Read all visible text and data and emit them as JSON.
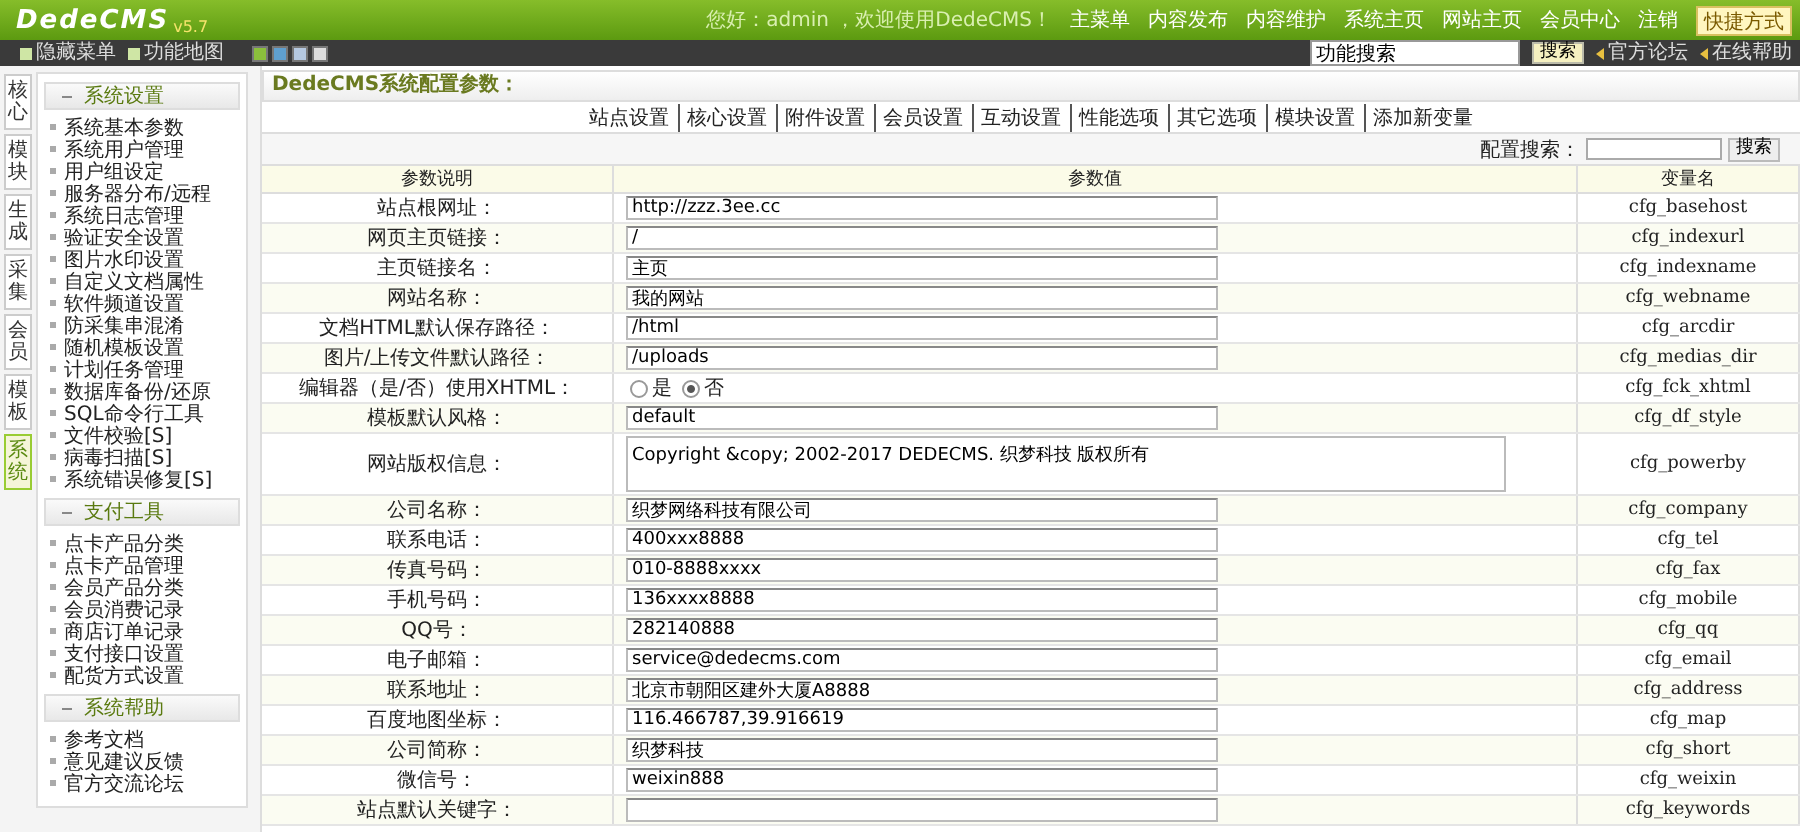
{
  "header": {
    "logo": "DedeCMS",
    "version": "v5.7",
    "greeting": "您好：admin ，欢迎使用DedeCMS！",
    "menu": [
      "主菜单",
      "内容发布",
      "内容维护",
      "系统主页",
      "网站主页",
      "会员中心",
      "注销"
    ],
    "shortcut": "快捷方式"
  },
  "toolbar": {
    "links": [
      "隐藏菜单",
      "功能地图"
    ],
    "search": {
      "value": "功能搜索"
    },
    "search_button": "搜索",
    "help_links": [
      "官方论坛",
      "在线帮助"
    ]
  },
  "side_tabs": [
    {
      "label": "核心",
      "selected": false
    },
    {
      "label": "模块",
      "selected": false
    },
    {
      "label": "生成",
      "selected": false
    },
    {
      "label": "采集",
      "selected": false
    },
    {
      "label": "会员",
      "selected": false
    },
    {
      "label": "模板",
      "selected": false
    },
    {
      "label": "系统",
      "selected": true
    }
  ],
  "sidebar": {
    "groups": [
      {
        "title": "系统设置",
        "expanded": true,
        "items": [
          "系统基本参数",
          "系统用户管理",
          "用户组设定",
          "服务器分布/远程",
          "系统日志管理",
          "验证安全设置",
          "图片水印设置",
          "自定义文档属性",
          "软件频道设置",
          "防采集串混淆",
          "随机模板设置",
          "计划任务管理",
          "数据库备份/还原",
          "SQL命令行工具",
          "文件校验[S]",
          "病毒扫描[S]",
          "系统错误修复[S]"
        ]
      },
      {
        "title": "支付工具",
        "expanded": true,
        "items": [
          "点卡产品分类",
          "点卡产品管理",
          "会员产品分类",
          "会员消费记录",
          "商店订单记录",
          "支付接口设置",
          "配货方式设置"
        ]
      },
      {
        "title": "系统帮助",
        "expanded": true,
        "items": [
          "参考文档",
          "意见建议反馈",
          "官方交流论坛"
        ]
      }
    ]
  },
  "main": {
    "title": "DedeCMS系统配置参数：",
    "tabs": [
      {
        "label": "站点设置",
        "selected": false
      },
      {
        "label": "核心设置",
        "selected": false
      },
      {
        "label": "附件设置",
        "selected": false
      },
      {
        "label": "会员设置",
        "selected": false
      },
      {
        "label": "互动设置",
        "selected": false
      },
      {
        "label": "性能选项",
        "selected": false
      },
      {
        "label": "其它选项",
        "selected": false
      },
      {
        "label": "模块设置",
        "selected": false
      },
      {
        "label": "添加新变量",
        "selected": false
      }
    ],
    "search_label": "配置搜索：",
    "search_button": "搜索",
    "columns": [
      "参数说明",
      "参数值",
      "变量名"
    ],
    "rows": [
      {
        "kind": "text",
        "label": "站点根网址：",
        "value": "http://zzz.3ee.cc",
        "variable": "cfg_basehost"
      },
      {
        "kind": "text",
        "label": "网页主页链接：",
        "value": "/",
        "variable": "cfg_indexurl"
      },
      {
        "kind": "text",
        "label": "主页链接名：",
        "value": "主页",
        "variable": "cfg_indexname"
      },
      {
        "kind": "text",
        "label": "网站名称：",
        "value": "我的网站",
        "variable": "cfg_webname"
      },
      {
        "kind": "text",
        "label": "文档HTML默认保存路径：",
        "value": "/html",
        "variable": "cfg_arcdir"
      },
      {
        "kind": "text",
        "label": "图片/上传文件默认路径：",
        "value": "/uploads",
        "variable": "cfg_medias_dir"
      },
      {
        "kind": "radio",
        "label": "编辑器（是/否）使用XHTML：",
        "options": [
          {
            "label": "是",
            "selected": false
          },
          {
            "label": "否",
            "selected": true
          }
        ],
        "variable": "cfg_fck_xhtml"
      },
      {
        "kind": "text",
        "label": "模板默认风格：",
        "value": "default",
        "variable": "cfg_df_style"
      },
      {
        "kind": "textarea",
        "label": "网站版权信息：",
        "value": "Copyright &copy; 2002-2017 DEDECMS. 织梦科技 版权所有",
        "variable": "cfg_powerby"
      },
      {
        "kind": "text",
        "label": "公司名称：",
        "value": "织梦网络科技有限公司",
        "variable": "cfg_company"
      },
      {
        "kind": "text",
        "label": "联系电话：",
        "value": "400xxx8888",
        "variable": "cfg_tel"
      },
      {
        "kind": "text",
        "label": "传真号码：",
        "value": "010-8888xxxx",
        "variable": "cfg_fax"
      },
      {
        "kind": "text",
        "label": "手机号码：",
        "value": "136xxxx8888",
        "variable": "cfg_mobile"
      },
      {
        "kind": "text",
        "label": "QQ号：",
        "value": "282140888",
        "variable": "cfg_qq"
      },
      {
        "kind": "text",
        "label": "电子邮箱：",
        "value": "service@dedecms.com",
        "variable": "cfg_email"
      },
      {
        "kind": "text",
        "label": "联系地址：",
        "value": "北京市朝阳区建外大厦A8888",
        "variable": "cfg_address"
      },
      {
        "kind": "text",
        "label": "百度地图坐标：",
        "value": "116.466787,39.916619",
        "variable": "cfg_map"
      },
      {
        "kind": "text",
        "label": "公司简称：",
        "value": "织梦科技",
        "variable": "cfg_short"
      },
      {
        "kind": "text",
        "label": "微信号：",
        "value": "weixin888",
        "variable": "cfg_weixin"
      },
      {
        "kind": "text",
        "label": "站点默认关键字：",
        "value": "",
        "variable": "cfg_keywords"
      }
    ]
  }
}
